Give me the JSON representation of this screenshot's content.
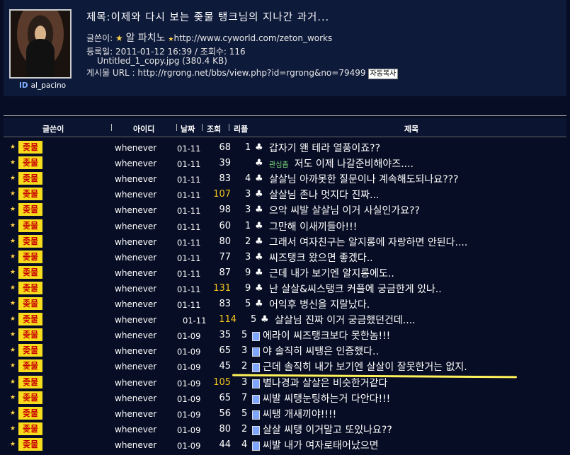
{
  "post": {
    "title": "제목:이제와 다시 보는 좆물 탱크님의 지나간 과거...",
    "author_label": "글쓴이:",
    "author_name": "알 파치노",
    "author_url": "http://www.cyworld.com/zeton_works",
    "date_line": "등록일: 2011-01-12 16:39 / 조회수: 116",
    "file_line": "Untitled_1_copy.jpg (380.4 KB)",
    "url_line": "게시물 URL : http://rgrong.net/bbs/view.php?id=rgrong&no=79499",
    "copy_button": "자동복사",
    "id_label": "ID",
    "user_id": "al_pacino"
  },
  "table": {
    "headers": {
      "author": "글쓴이",
      "id": "아이디",
      "date": "날짜",
      "views": "조회",
      "replies": "리플",
      "title": "제목"
    },
    "rows": [
      {
        "nick": "좆물",
        "id": "whenever",
        "date": "01-11",
        "views": "68",
        "hot": false,
        "replies": "1",
        "icon": "club",
        "title": "갑자기 왠 테라 열풍이죠??"
      },
      {
        "nick": "좆물",
        "id": "whenever",
        "date": "01-11",
        "views": "39",
        "hot": false,
        "replies": "",
        "icon": "club",
        "tag": "관심좀",
        "title": "저도 이제 나갈준비해야즈...."
      },
      {
        "nick": "좆물",
        "id": "whenever",
        "date": "01-11",
        "views": "83",
        "hot": false,
        "replies": "4",
        "icon": "club",
        "title": "살살님 아까못한 질문이나 계속해도되나요???"
      },
      {
        "nick": "좆물",
        "id": "whenever",
        "date": "01-11",
        "views": "107",
        "hot": true,
        "replies": "3",
        "icon": "club",
        "title": "살살님 존나 멋지다 진짜..."
      },
      {
        "nick": "좆물",
        "id": "whenever",
        "date": "01-11",
        "views": "98",
        "hot": false,
        "replies": "3",
        "icon": "club",
        "title": "으악 씨발 살살님 이거 사실인가요??"
      },
      {
        "nick": "좆물",
        "id": "whenever",
        "date": "01-11",
        "views": "60",
        "hot": false,
        "replies": "1",
        "icon": "club",
        "title": "그만해 이새끼들아!!!"
      },
      {
        "nick": "좆물",
        "id": "whenever",
        "date": "01-11",
        "views": "80",
        "hot": false,
        "replies": "2",
        "icon": "club",
        "title": "그래서 여자친구는 알지롱에 자랑하면 안된다...."
      },
      {
        "nick": "좆물",
        "id": "whenever",
        "date": "01-11",
        "views": "77",
        "hot": false,
        "replies": "3",
        "icon": "club",
        "title": "씨즈탱크 왔으면 좋겠다.."
      },
      {
        "nick": "좆물",
        "id": "whenever",
        "date": "01-11",
        "views": "87",
        "hot": false,
        "replies": "9",
        "icon": "club",
        "title": "근데 내가 보기엔 알지롱에도.."
      },
      {
        "nick": "좆물",
        "id": "whenever",
        "date": "01-11",
        "views": "131",
        "hot": true,
        "replies": "9",
        "icon": "club",
        "title": "난 살살&씨스탱크 커플에 궁금한게 있나.."
      },
      {
        "nick": "좆물",
        "id": "whenever",
        "date": "01-11",
        "views": "83",
        "hot": false,
        "replies": "5",
        "icon": "club",
        "title": "어익후 병신을 지랄났다."
      },
      {
        "nick": "좆물",
        "id": "whenever",
        "date": "01-11",
        "views": "114",
        "hot": true,
        "replies": "5",
        "icon": "club",
        "title": "살살님 진짜 이거 궁금했던건데...."
      },
      {
        "nick": "좆물",
        "id": "whenever",
        "date": "01-09",
        "views": "35",
        "hot": false,
        "replies": "5",
        "icon": "memo",
        "title": "에라이 씨즈탱크보다 못한놈!!!"
      },
      {
        "nick": "좆물",
        "id": "whenever",
        "date": "01-09",
        "views": "65",
        "hot": false,
        "replies": "3",
        "icon": "memo",
        "title": "야 솔직히 씨탱은 인증했다.."
      },
      {
        "nick": "좆물",
        "id": "whenever",
        "date": "01-09",
        "views": "45",
        "hot": false,
        "replies": "2",
        "icon": "memo",
        "title": "근데 솔직히 내가 보기엔 살살이 잘못한거는 없지."
      },
      {
        "nick": "좆물",
        "id": "whenever",
        "date": "01-09",
        "views": "105",
        "hot": true,
        "replies": "3",
        "icon": "memo",
        "title": "별나경과 살살은 비슷한거같다"
      },
      {
        "nick": "좆물",
        "id": "whenever",
        "date": "01-09",
        "views": "65",
        "hot": false,
        "replies": "7",
        "icon": "memo",
        "title": "씨발 씨탱눈팅하는거 다안다!!!"
      },
      {
        "nick": "좆물",
        "id": "whenever",
        "date": "01-09",
        "views": "56",
        "hot": false,
        "replies": "5",
        "icon": "memo",
        "title": "씨탱 개새끼야!!!!"
      },
      {
        "nick": "좆물",
        "id": "whenever",
        "date": "01-09",
        "views": "80",
        "hot": false,
        "replies": "2",
        "icon": "memo",
        "title": "살살 씨탱 이거말고 또있나요??"
      },
      {
        "nick": "좆물",
        "id": "whenever",
        "date": "01-09",
        "views": "44",
        "hot": false,
        "replies": "4",
        "icon": "memo",
        "title": "씨발 내가 여자로태어났으면"
      }
    ]
  }
}
